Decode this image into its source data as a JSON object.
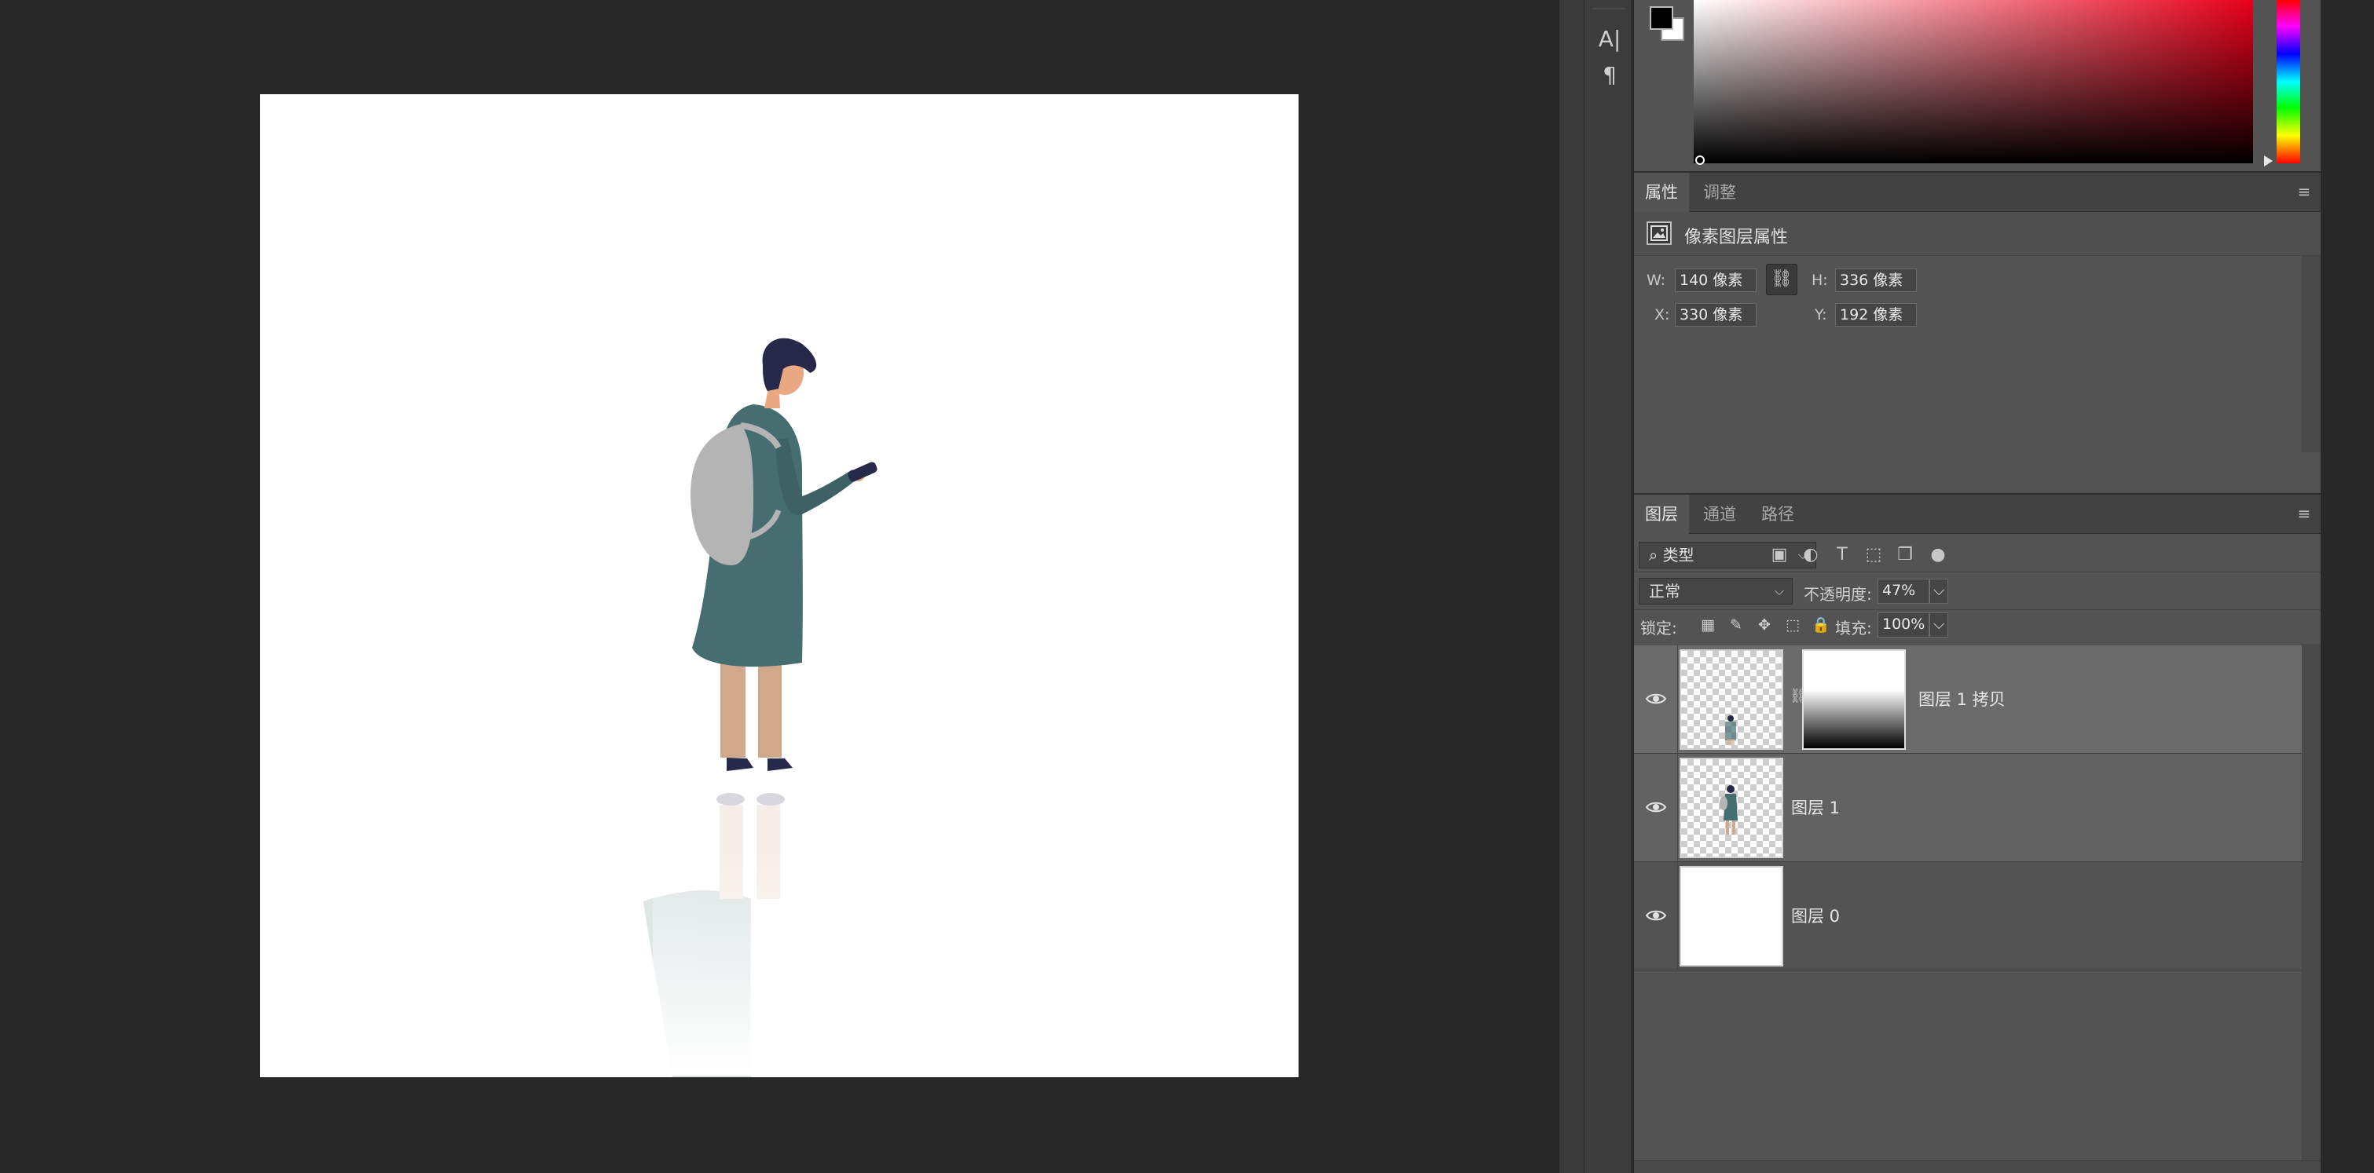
{
  "tools": {
    "type_vertical_label": "A|",
    "paragraph_label": "¶"
  },
  "colors": {
    "foreground": "#000000",
    "background": "#ffffff",
    "hue": "#e8001a"
  },
  "properties_panel": {
    "tabs": [
      {
        "label": "属性",
        "active": true
      },
      {
        "label": "调整",
        "active": false
      }
    ],
    "menu_icon": "menu-icon",
    "header_label": "像素图层属性",
    "w_label": "W:",
    "w_value": "140 像素",
    "h_label": "H:",
    "h_value": "336 像素",
    "x_label": "X:",
    "x_value": "330 像素",
    "y_label": "Y:",
    "y_value": "192 像素"
  },
  "layers_panel": {
    "tabs": [
      {
        "label": "图层",
        "active": true
      },
      {
        "label": "通道",
        "active": false
      },
      {
        "label": "路径",
        "active": false
      }
    ],
    "filter_kind": "类型",
    "blend_mode": "正常",
    "opacity_label": "不透明度:",
    "opacity_value": "47%",
    "lock_label": "锁定:",
    "fill_label": "填充:",
    "fill_value": "100%",
    "layers": [
      {
        "name": "图层 1 拷贝",
        "visible": true,
        "has_mask": true,
        "selected": true
      },
      {
        "name": "图层 1",
        "visible": true,
        "has_mask": false,
        "selected": false
      },
      {
        "name": "图层 0",
        "visible": true,
        "has_mask": false,
        "selected": false
      }
    ]
  }
}
